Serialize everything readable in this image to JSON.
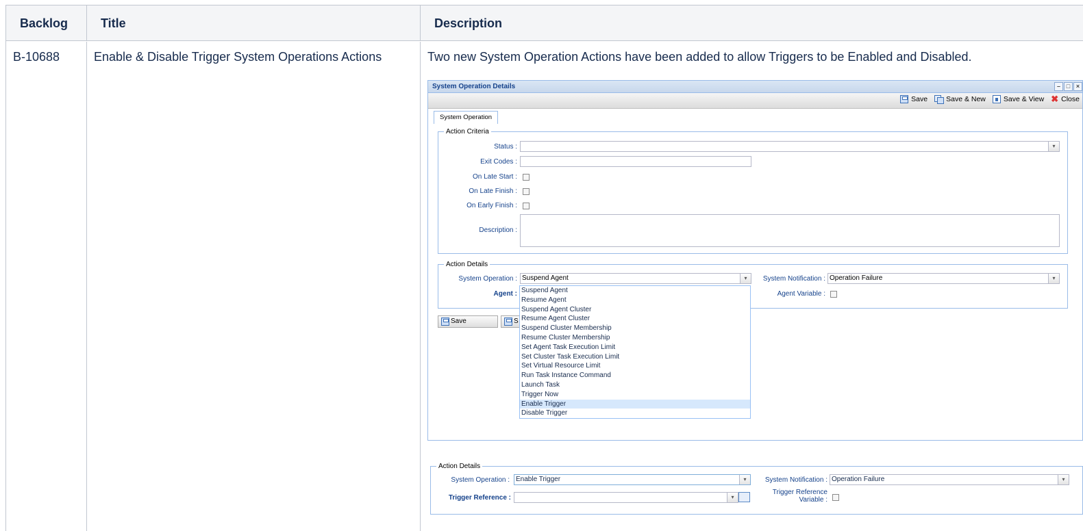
{
  "table": {
    "headers": [
      "Backlog",
      "Title",
      "Description"
    ],
    "row": {
      "backlog": "B-10688",
      "title": "Enable & Disable Trigger System Operations Actions",
      "description": "Two new System Operation Actions have been added to allow Triggers to be Enabled and Disabled."
    }
  },
  "window": {
    "title": "System Operation Details",
    "tools": [
      "–",
      "□",
      "×"
    ],
    "toolbar": {
      "save": "Save",
      "save_new": "Save & New",
      "save_view": "Save & View",
      "close": "Close"
    },
    "tab": "System Operation",
    "action_criteria": {
      "legend": "Action Criteria",
      "status_label": "Status :",
      "status_value": "",
      "exit_codes_label": "Exit Codes :",
      "exit_codes_value": "",
      "late_start_label": "On Late Start :",
      "late_finish_label": "On Late Finish :",
      "early_finish_label": "On Early Finish :",
      "description_label": "Description :"
    },
    "action_details": {
      "legend": "Action Details",
      "system_operation_label": "System Operation :",
      "system_operation_value": "Suspend Agent",
      "system_notification_label": "System Notification :",
      "system_notification_value": "Operation Failure",
      "agent_label": "Agent :",
      "agent_variable_label": "Agent Variable :"
    },
    "bottom_buttons": {
      "save": "Save",
      "second_partial": "S"
    },
    "dropdown_options": [
      "Suspend Agent",
      "Resume Agent",
      "Suspend Agent Cluster",
      "Resume Agent Cluster",
      "Suspend Cluster Membership",
      "Resume Cluster Membership",
      "Set Agent Task Execution Limit",
      "Set Cluster Task Execution Limit",
      "Set Virtual Resource Limit",
      "Run Task Instance Command",
      "Launch Task",
      "Trigger Now",
      "Enable Trigger",
      "Disable Trigger"
    ],
    "dropdown_selected": "Enable Trigger"
  },
  "action_details_2": {
    "legend": "Action Details",
    "system_operation_label": "System Operation :",
    "system_operation_value": "Enable Trigger",
    "system_notification_label": "System Notification :",
    "system_notification_value": "Operation Failure",
    "trigger_reference_label": "Trigger Reference :",
    "trigger_reference_value": "",
    "trigger_reference_variable_label_1": "Trigger Reference",
    "trigger_reference_variable_label_2": "Variable :"
  }
}
